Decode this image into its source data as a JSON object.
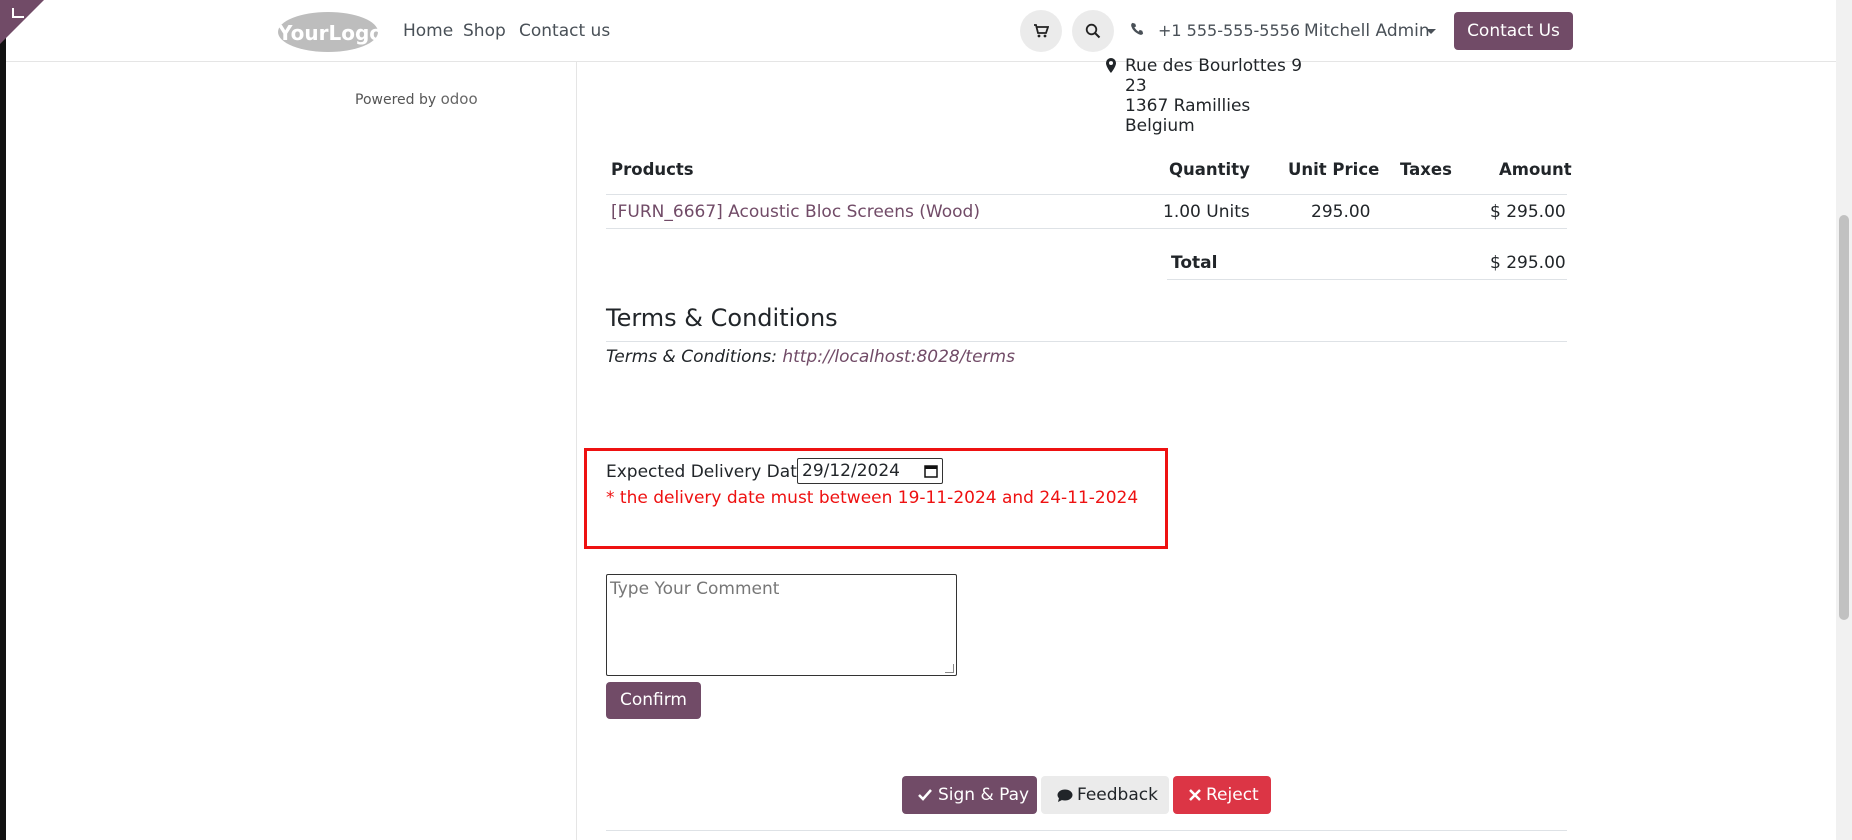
{
  "colors": {
    "brand": "#714B67",
    "error": "#ee1111",
    "danger": "#dc3545"
  },
  "navbar": {
    "logo_text": "YourLogo",
    "links": [
      "Home",
      "Shop",
      "Contact us"
    ],
    "cart_icon": "cart-icon",
    "search_icon": "search-icon",
    "phone": "+1 555-555-5556",
    "user": "Mitchell Admin",
    "contact_button": "Contact Us"
  },
  "sidebar": {
    "powered_by": "Powered by",
    "powered_brand": "odoo"
  },
  "address": {
    "lines": [
      "Rue des Bourlottes 9",
      "23",
      "1367 Ramillies",
      "Belgium"
    ]
  },
  "products_table": {
    "headers": [
      "Products",
      "Quantity",
      "Unit Price",
      "Taxes",
      "Amount"
    ],
    "rows": [
      {
        "product": "[FURN_6667] Acoustic Bloc Screens (Wood)",
        "quantity": "1.00 Units",
        "unit_price": "295.00",
        "taxes": "",
        "amount": "$ 295.00"
      }
    ],
    "total_label": "Total",
    "total_value": "$ 295.00"
  },
  "terms": {
    "title": "Terms & Conditions",
    "label": "Terms & Conditions:",
    "link": "http://localhost:8028/terms"
  },
  "delivery": {
    "label": "Expected Delivery Date :",
    "date_value": "29/12/2024",
    "error": "* the delivery date must between 19-11-2024 and 24-11-2024"
  },
  "comment": {
    "placeholder": "Type Your Comment",
    "confirm_label": "Confirm"
  },
  "actions": {
    "sign_pay": "Sign & Pay",
    "feedback": "Feedback",
    "reject": "Reject"
  }
}
